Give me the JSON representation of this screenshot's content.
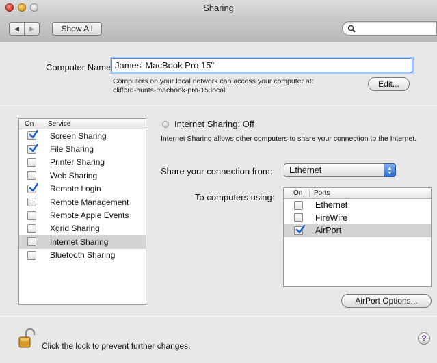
{
  "window": {
    "title": "Sharing"
  },
  "toolbar": {
    "back_icon": "◀",
    "forward_icon": "▶",
    "show_all_label": "Show All",
    "search_placeholder": "",
    "search_icon": "search-icon"
  },
  "computer_name": {
    "label": "Computer Name:",
    "value": "James' MacBook Pro 15\"",
    "info_line1": "Computers on your local network can access your computer at:",
    "info_line2": "clifford-hunts-macbook-pro-15.local",
    "edit_label": "Edit..."
  },
  "services": {
    "header_on": "On",
    "header_service": "Service",
    "items": [
      {
        "label": "Screen Sharing",
        "checked": true,
        "selected": false
      },
      {
        "label": "File Sharing",
        "checked": true,
        "selected": false
      },
      {
        "label": "Printer Sharing",
        "checked": false,
        "selected": false
      },
      {
        "label": "Web Sharing",
        "checked": false,
        "selected": false
      },
      {
        "label": "Remote Login",
        "checked": true,
        "selected": false
      },
      {
        "label": "Remote Management",
        "checked": false,
        "selected": false
      },
      {
        "label": "Remote Apple Events",
        "checked": false,
        "selected": false
      },
      {
        "label": "Xgrid Sharing",
        "checked": false,
        "selected": false
      },
      {
        "label": "Internet Sharing",
        "checked": false,
        "selected": true
      },
      {
        "label": "Bluetooth Sharing",
        "checked": false,
        "selected": false
      }
    ]
  },
  "detail": {
    "status": "Internet Sharing: Off",
    "description": "Internet Sharing allows other computers to share your connection to the Internet.",
    "share_from_label": "Share your connection from:",
    "share_from_value": "Ethernet",
    "to_computers_label": "To computers using:",
    "ports_header_on": "On",
    "ports_header_ports": "Ports",
    "ports": [
      {
        "label": "Ethernet",
        "checked": false,
        "selected": false
      },
      {
        "label": "FireWire",
        "checked": false,
        "selected": false
      },
      {
        "label": "AirPort",
        "checked": true,
        "selected": true
      }
    ],
    "airport_options_label": "AirPort Options..."
  },
  "footer": {
    "lock_text": "Click the lock to prevent further changes.",
    "help_label": "?"
  },
  "colors": {
    "selection_gray": "#d4d4d4",
    "focus_ring": "#a6c6ee",
    "select_arrows_blue": "#2f6fd1",
    "checkmark_blue": "#1f5fc8"
  }
}
